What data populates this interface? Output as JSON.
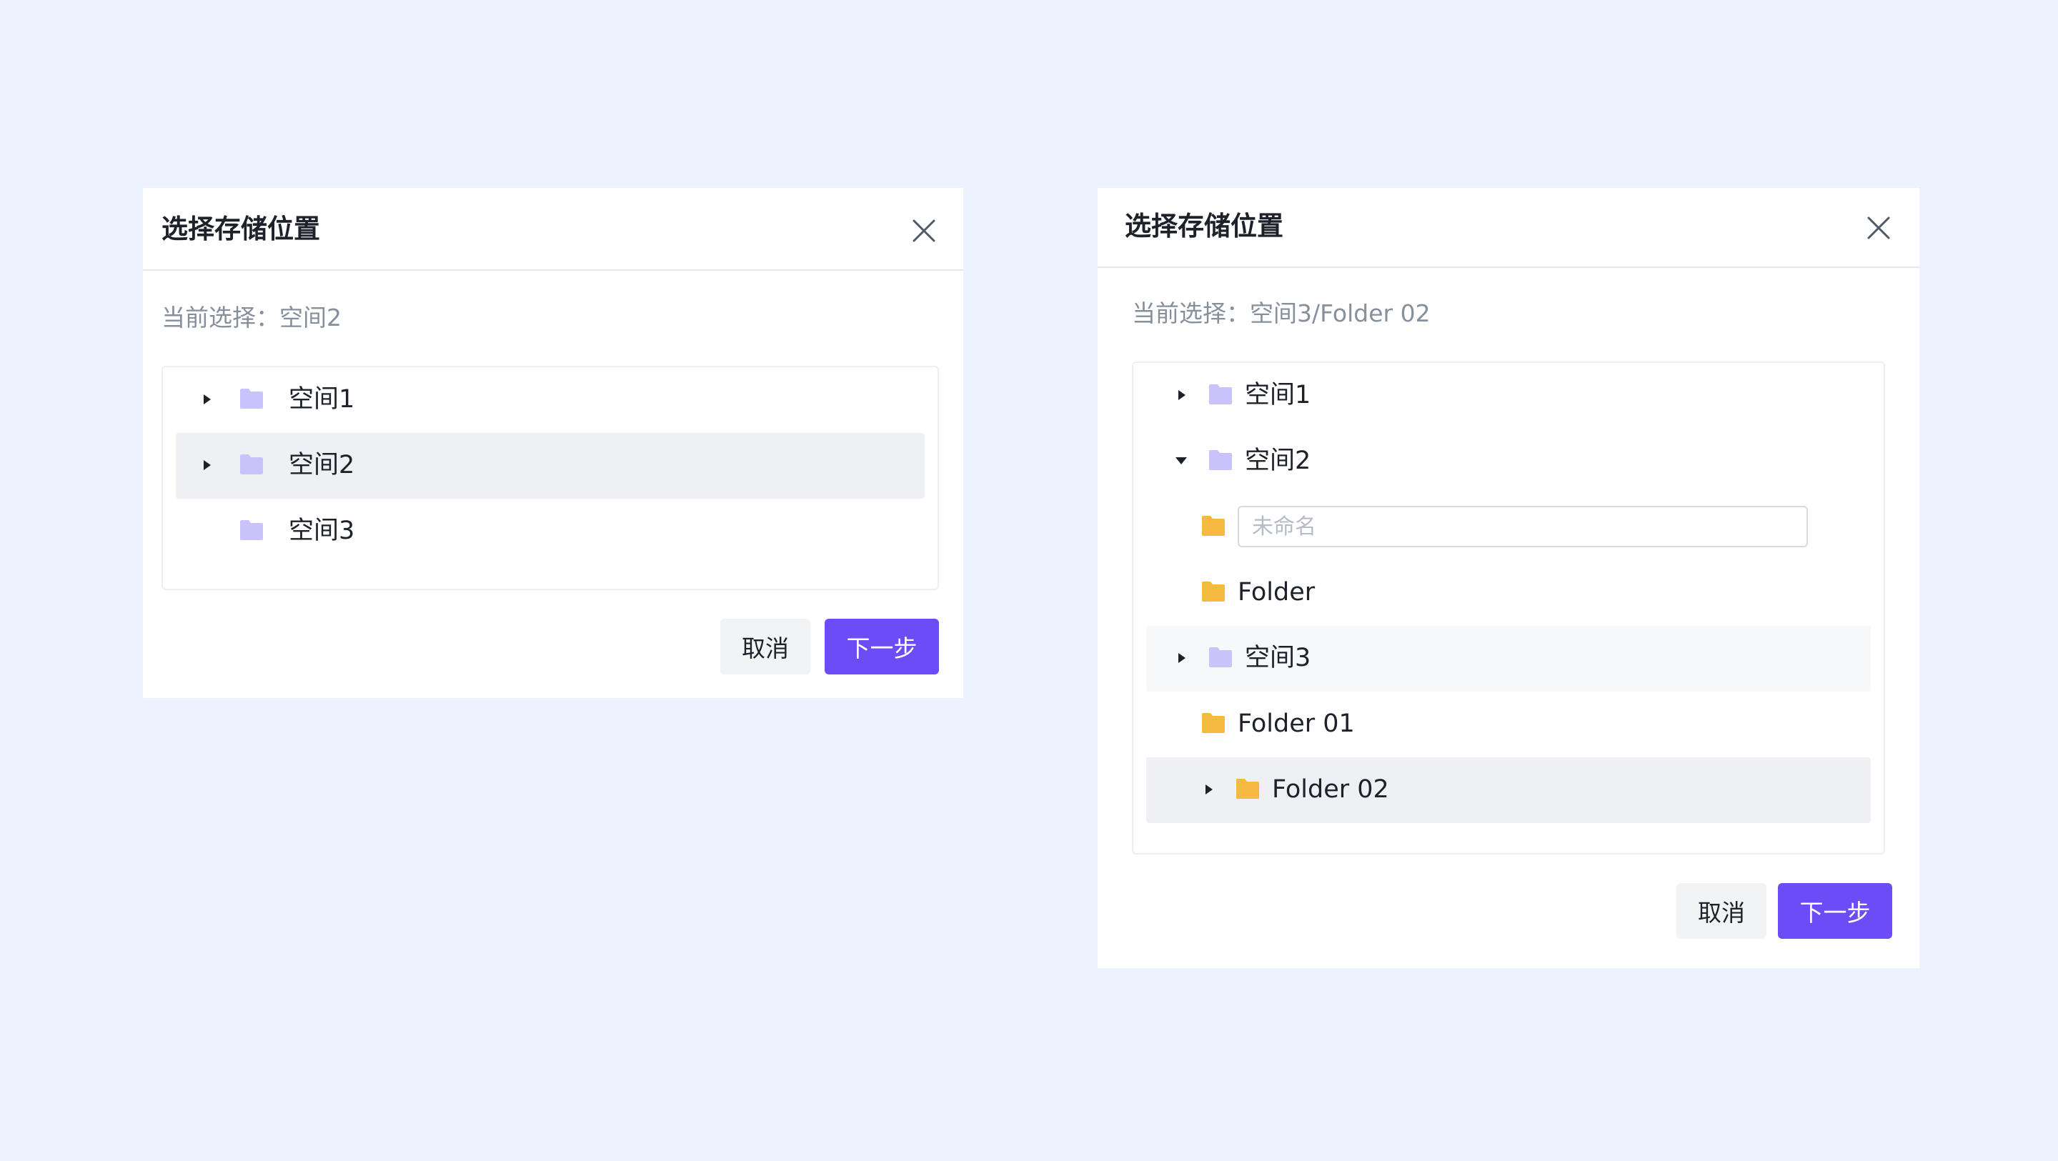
{
  "colors": {
    "page_background": "#ecf2fe",
    "primary": "#6b4cf6",
    "space_folder": "#c9c3fb",
    "folder": "#f5b941",
    "selected_row": "#eff0f3"
  },
  "dialog_left": {
    "title": "选择存储位置",
    "current_label": "当前选择：",
    "current_value": "空间2",
    "tree": [
      {
        "label": "空间1",
        "icon": "space-folder-icon",
        "arrow": "caret-right-icon"
      },
      {
        "label": "空间2",
        "icon": "space-folder-icon",
        "arrow": "caret-right-icon",
        "state": "selected"
      },
      {
        "label": "空间3",
        "icon": "space-folder-icon",
        "arrow": ""
      }
    ],
    "cancel_label": "取消",
    "next_label": "下一步"
  },
  "dialog_right": {
    "title": "选择存储位置",
    "current_label": "当前选择：",
    "current_value": "空间3/Folder 02",
    "tree": [
      {
        "label": "空间1",
        "icon": "space-folder-icon",
        "arrow": "caret-right-icon"
      },
      {
        "label": "空间2",
        "icon": "space-folder-icon",
        "arrow": "caret-down-icon"
      },
      {
        "label": "",
        "icon": "folder-icon",
        "input_placeholder": "未命名"
      },
      {
        "label": "Folder",
        "icon": "folder-icon"
      },
      {
        "label": "空间3",
        "icon": "space-folder-icon",
        "arrow": "caret-right-icon",
        "state": "hovered"
      },
      {
        "label": "Folder 01",
        "icon": "folder-icon"
      },
      {
        "label": "Folder 02",
        "icon": "folder-icon",
        "arrow": "caret-right-icon",
        "state": "selected"
      }
    ],
    "cancel_label": "取消",
    "next_label": "下一步"
  }
}
